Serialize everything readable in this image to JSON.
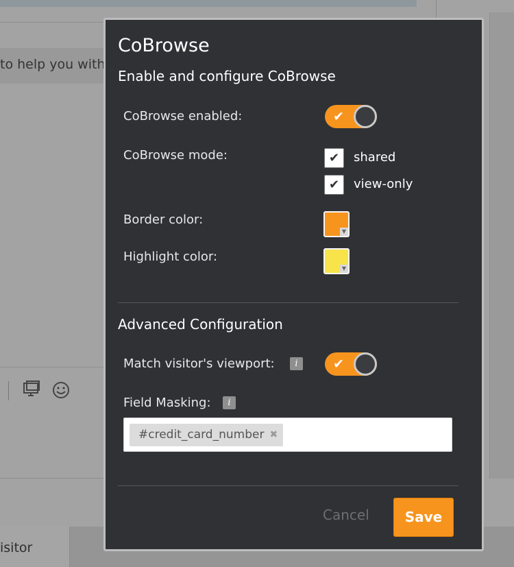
{
  "background": {
    "message_text": "to help you with",
    "visitor_tab": "isitor",
    "toolbar_icons": [
      "screen-share-icon",
      "emoji-icon"
    ]
  },
  "modal": {
    "title": "CoBrowse",
    "subtitle": "Enable and configure CoBrowse",
    "cobrowse_enabled": {
      "label": "CoBrowse enabled:",
      "on": true
    },
    "cobrowse_mode": {
      "label": "CoBrowse mode:",
      "options": [
        {
          "label": "shared",
          "checked": true
        },
        {
          "label": "view-only",
          "checked": true
        }
      ]
    },
    "border_color": {
      "label": "Border color:",
      "value": "#f7941d"
    },
    "highlight_color": {
      "label": "Highlight color:",
      "value": "#f8e34a"
    },
    "advanced_title": "Advanced Configuration",
    "match_viewport": {
      "label": "Match visitor's viewport:",
      "on": true,
      "info_icon": "i"
    },
    "field_masking": {
      "label": "Field Masking:",
      "info_icon": "i",
      "tags": [
        "#credit_card_number"
      ]
    },
    "cancel_label": "Cancel",
    "save_label": "Save"
  },
  "colors": {
    "accent": "#f7941d",
    "modal_bg": "#2f3135"
  }
}
